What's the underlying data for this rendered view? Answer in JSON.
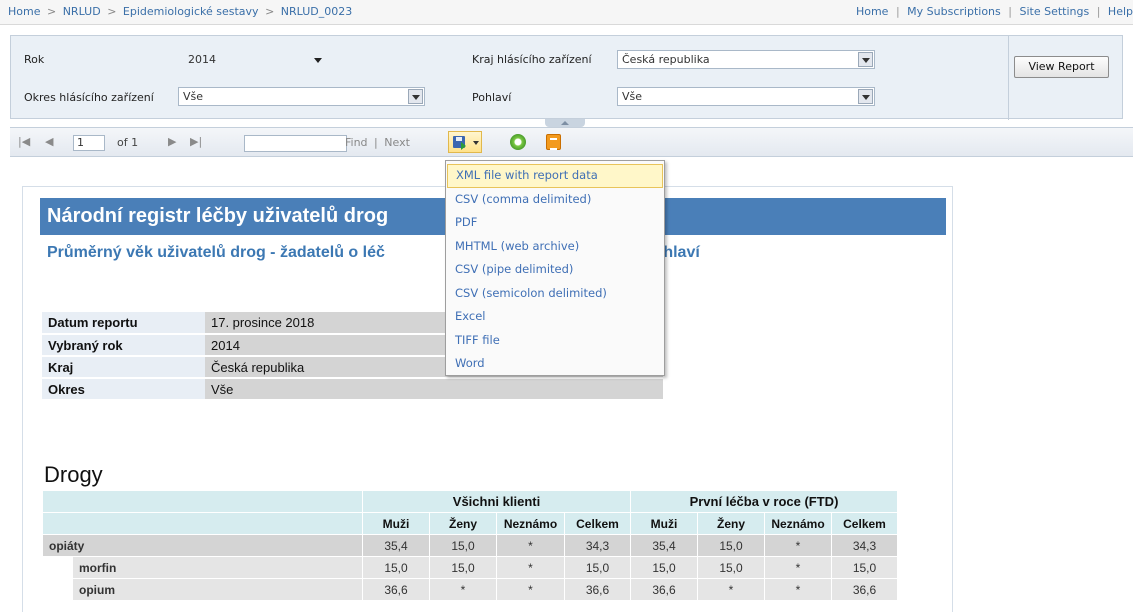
{
  "breadcrumb": [
    "Home",
    "NRLUD",
    "Epidemiologické sestavy",
    "NRLUD_0023"
  ],
  "breadcrumb_sep": ">",
  "top_links": [
    "Home",
    "My Subscriptions",
    "Site Settings",
    "Help"
  ],
  "top_links_sep": "|",
  "params": {
    "rok": {
      "label": "Rok",
      "value": "2014"
    },
    "kraj": {
      "label": "Kraj hlásícího zařízení",
      "value": "Česká republika"
    },
    "okres": {
      "label": "Okres hlásícího zařízení",
      "value": "Vše"
    },
    "pohlavi": {
      "label": "Pohlaví",
      "value": "Vše"
    },
    "view_report": "View Report"
  },
  "toolbar": {
    "page": "1",
    "of_label": "of 1",
    "find": "Find",
    "next": "Next",
    "find_sep": "|"
  },
  "export_menu": [
    "XML file with report data",
    "CSV (comma delimited)",
    "PDF",
    "MHTML (web archive)",
    "CSV (pipe delimited)",
    "CSV (semicolon delimited)",
    "Excel",
    "TIFF file",
    "Word"
  ],
  "report": {
    "title": "Národní registr léčby uživatelů drog",
    "subtitle": "Průměrný věk uživatelů drog - žadatelů o léč",
    "subtitle_tail": "ní drogy a pohlaví",
    "info": [
      {
        "key": "Datum reportu",
        "value": "17. prosince 2018"
      },
      {
        "key": "Vybraný rok",
        "value": "2014"
      },
      {
        "key": "Kraj",
        "value": "Česká republika"
      },
      {
        "key": "Okres",
        "value": "Vše"
      }
    ],
    "section_title": "Drogy",
    "table": {
      "group1": "Všichni klienti",
      "group2": "První léčba v roce (FTD)",
      "columns": [
        "Muži",
        "Ženy",
        "Neznámo",
        "Celkem",
        "Muži",
        "Ženy",
        "Neznámo",
        "Celkem"
      ],
      "rows": [
        {
          "name": "opiáty",
          "values": [
            "35,4",
            "15,0",
            "*",
            "34,3",
            "35,4",
            "15,0",
            "*",
            "34,3"
          ]
        },
        {
          "name": "morfin",
          "values": [
            "15,0",
            "15,0",
            "*",
            "15,0",
            "15,0",
            "15,0",
            "*",
            "15,0"
          ]
        },
        {
          "name": "opium",
          "values": [
            "36,6",
            "*",
            "*",
            "36,6",
            "36,6",
            "*",
            "*",
            "36,6"
          ]
        }
      ]
    }
  }
}
